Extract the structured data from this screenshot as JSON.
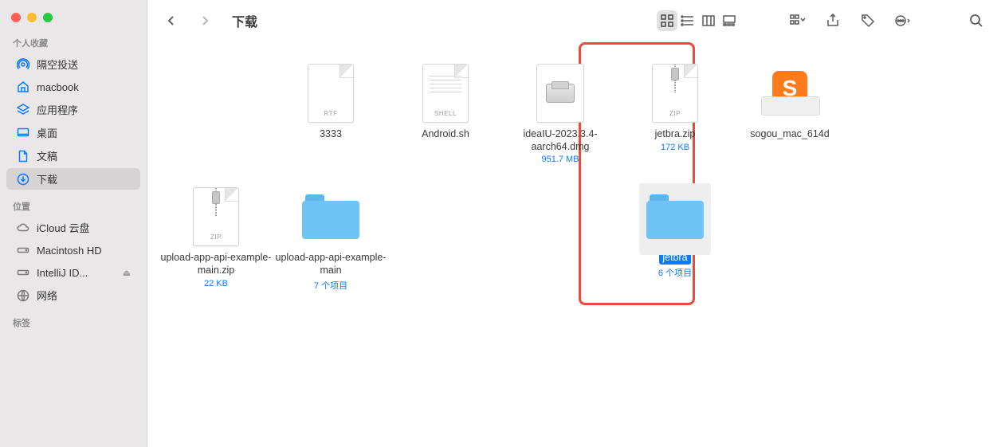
{
  "traffic": {
    "close": "close",
    "min": "minimize",
    "max": "maximize"
  },
  "title": "下载",
  "sidebar": {
    "section_fav": "个人收藏",
    "section_loc": "位置",
    "section_tags": "标签",
    "fav": [
      {
        "label": "隔空投送",
        "icon": "airdrop"
      },
      {
        "label": "macbook",
        "icon": "house"
      },
      {
        "label": "应用程序",
        "icon": "app"
      },
      {
        "label": "桌面",
        "icon": "desktop"
      },
      {
        "label": "文稿",
        "icon": "doc"
      },
      {
        "label": "下载",
        "icon": "download"
      }
    ],
    "loc": [
      {
        "label": "iCloud 云盘",
        "icon": "cloud"
      },
      {
        "label": "Macintosh HD",
        "icon": "drive"
      },
      {
        "label": "IntelliJ ID...",
        "icon": "drive",
        "eject": true
      },
      {
        "label": "网络",
        "icon": "globe"
      }
    ]
  },
  "files": [
    {
      "name": "3333",
      "kind": "RTF",
      "type": "rtf",
      "meta": ""
    },
    {
      "name": "Android.sh",
      "kind": "SHELL",
      "type": "shell",
      "meta": ""
    },
    {
      "name": "ideaIU-2023.3.4-aarch64.dmg",
      "kind": "",
      "type": "dmg",
      "meta": "951.7 MB"
    },
    {
      "name": "jetbra.zip",
      "kind": "ZIP",
      "type": "zip",
      "meta": "172 KB"
    },
    {
      "name": "sogou_mac_614d",
      "kind": "",
      "type": "sogou",
      "meta": ""
    },
    {
      "name": "upload-app-api-example-main.zip",
      "kind": "ZIP",
      "type": "zip",
      "meta": "22 KB"
    },
    {
      "name": "upload-app-api-example-main",
      "kind": "",
      "type": "folder",
      "meta": "7 个项目"
    },
    {
      "name": "jetbra",
      "kind": "",
      "type": "folder",
      "meta": "6 个项目",
      "selected": true
    }
  ]
}
